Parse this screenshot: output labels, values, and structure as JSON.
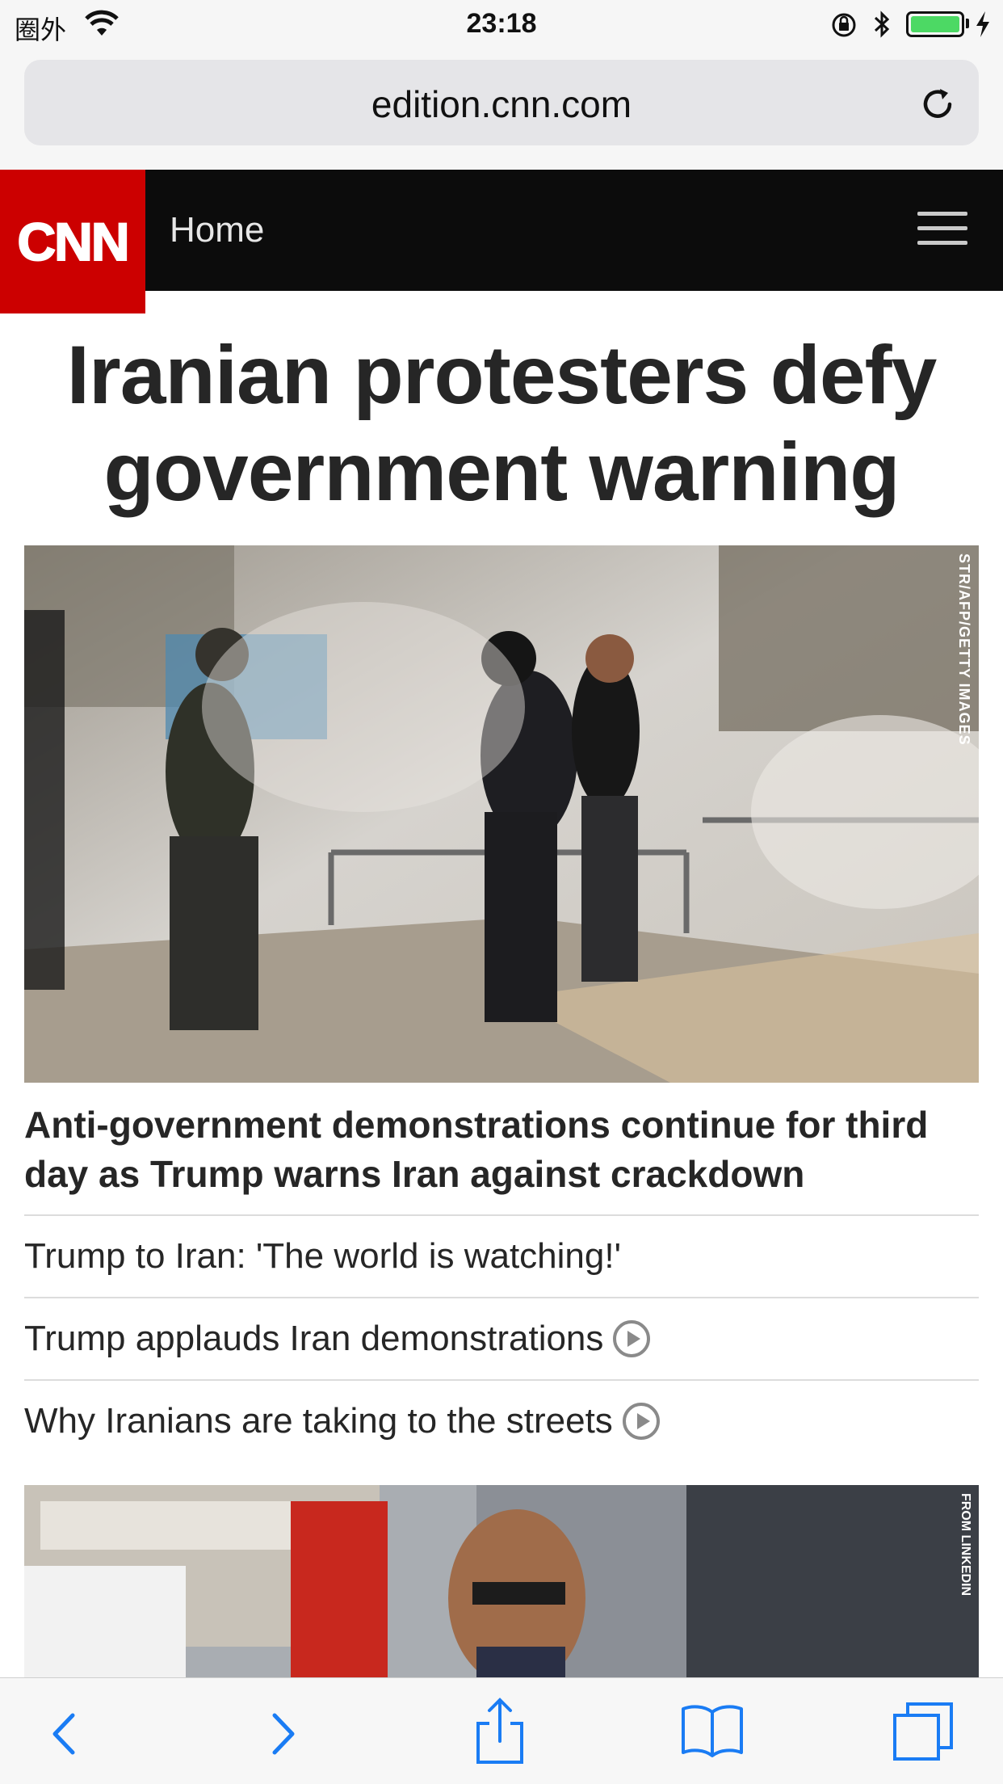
{
  "status_bar": {
    "carrier": "圈外",
    "time": "23:18",
    "battery_level": 1.0,
    "icons": [
      "wifi-icon",
      "orientation-lock-icon",
      "bluetooth-icon",
      "battery-icon",
      "charging-icon"
    ]
  },
  "browser": {
    "url": "edition.cnn.com"
  },
  "site_nav": {
    "logo": "CNN",
    "section": "Home",
    "menu_icon": "hamburger-menu-icon"
  },
  "article": {
    "headline": "Iranian protesters defy government warning",
    "image_credit": "STR/AFP/GETTY IMAGES",
    "subheadline": "Anti-government demonstrations continue for third day as Trump warns Iran against crackdown",
    "related": [
      {
        "label": "Trump to Iran: 'The world is watching!'",
        "video": false
      },
      {
        "label": "Trump applauds Iran demonstrations",
        "video": true
      },
      {
        "label": "Why Iranians are taking to the streets",
        "video": true
      }
    ]
  },
  "next_story": {
    "image_credit": "FROM LINKEDIN"
  },
  "colors": {
    "brand_red": "#cc0000",
    "nav_black": "#0c0c0c",
    "ios_blue": "#1a7cf4"
  }
}
